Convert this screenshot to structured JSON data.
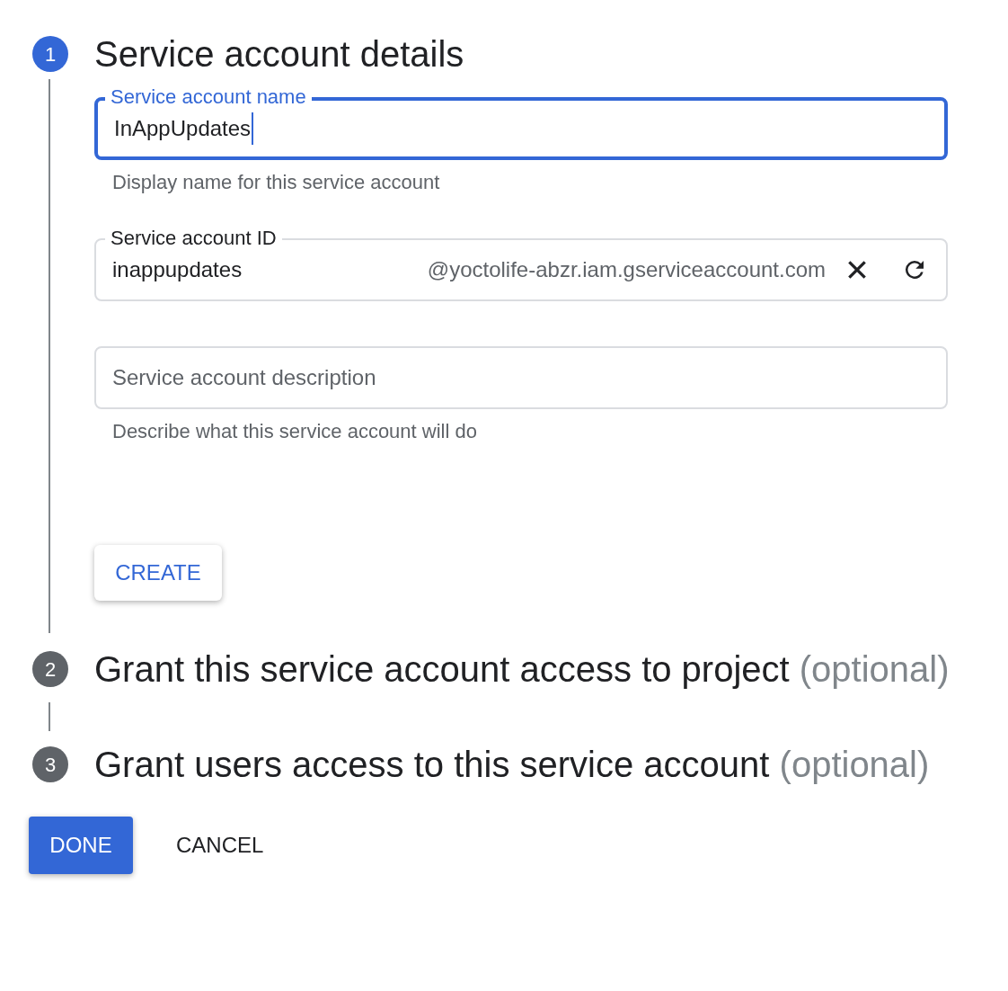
{
  "steps": [
    {
      "number": "1",
      "title": "Service account details",
      "active": true
    },
    {
      "number": "2",
      "title": "Grant this service account access to project",
      "optional": "(optional)",
      "active": false
    },
    {
      "number": "3",
      "title": "Grant users access to this service account",
      "optional": "(optional)",
      "active": false
    }
  ],
  "name_field": {
    "label": "Service account name",
    "value": "InAppUpdates",
    "focused": true,
    "helper": "Display name for this service account"
  },
  "id_field": {
    "label": "Service account ID",
    "value": "inappupdates",
    "suffix": "@yoctolife-abzr.iam.gserviceaccount.com",
    "focused": false
  },
  "description_field": {
    "placeholder": "Service account description",
    "helper": "Describe what this service account will do"
  },
  "create_button": "CREATE",
  "done_button": "DONE",
  "cancel_button": "CANCEL"
}
